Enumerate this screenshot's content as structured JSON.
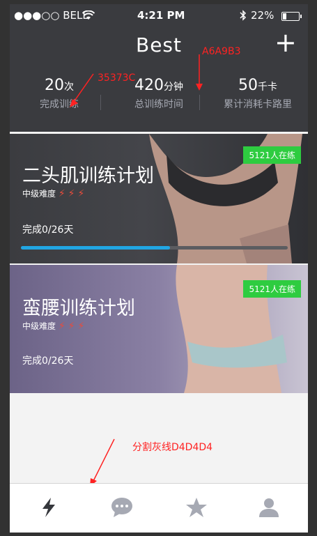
{
  "status_bar": {
    "carrier": "●●●○○ BELL",
    "time": "4:21 PM",
    "battery_pct": "22%"
  },
  "header": {
    "title": "Best",
    "add_label": "+"
  },
  "stats": [
    {
      "num": "20",
      "unit": "次",
      "label": "完成训练"
    },
    {
      "num": "420",
      "unit": "分钟",
      "label": "总训练时间"
    },
    {
      "num": "50",
      "unit": "千卡",
      "label": "累计消耗卡路里"
    }
  ],
  "annotations": {
    "label_color": "35373C",
    "bg_color": "A6A9B3",
    "divider": "分割灰线D4D4D4"
  },
  "plans": [
    {
      "name": "二头肌训练计划",
      "difficulty": "中级难度",
      "bolts": "⚡⚡⚡",
      "progress_text": "完成0/26天",
      "participants": "5121人在练",
      "progress_fraction": 0.56
    },
    {
      "name": "蛮腰训练计划",
      "difficulty": "中级难度",
      "bolts": "⚡⚡⚡",
      "progress_text": "完成0/26天",
      "participants": "5121人在练"
    }
  ],
  "tabs": [
    "bolt-icon",
    "chat-icon",
    "star-icon",
    "user-icon"
  ],
  "colors": {
    "header_bg": "#3A3B3F",
    "badge": "#2ECC40",
    "progress": "#21A6E3",
    "divider": "#D4D4D4"
  }
}
